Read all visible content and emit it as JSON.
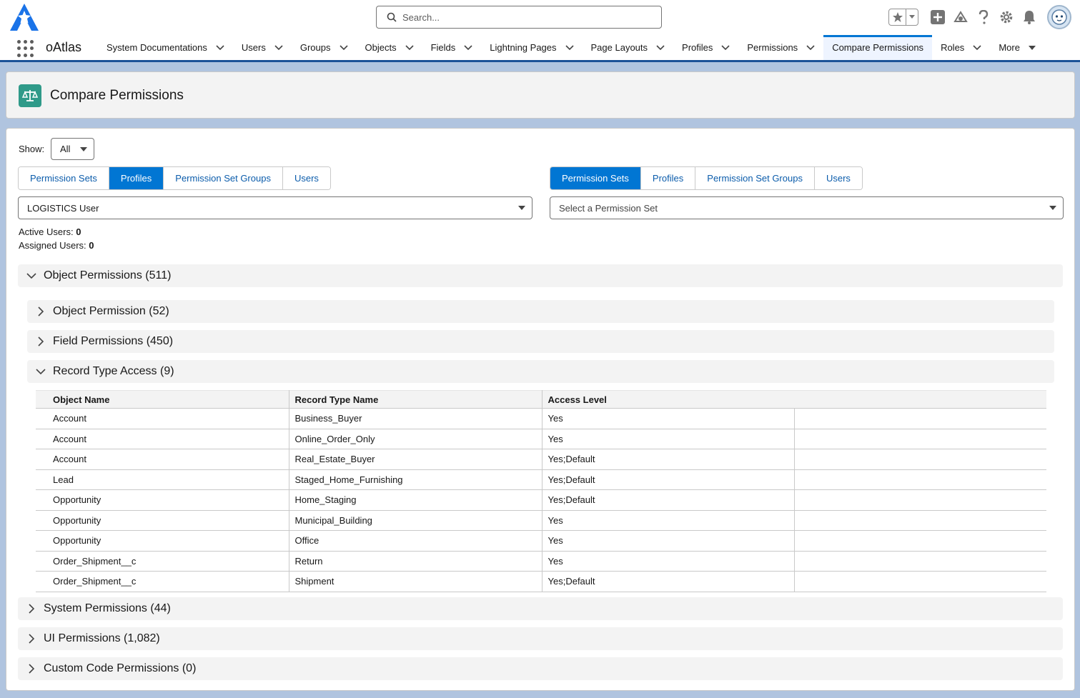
{
  "search": {
    "placeholder": "Search..."
  },
  "app": {
    "name": "oAtlas"
  },
  "nav": {
    "tabs": [
      {
        "label": "System Documentations",
        "has_menu": true
      },
      {
        "label": "Users",
        "has_menu": true
      },
      {
        "label": "Groups",
        "has_menu": true
      },
      {
        "label": "Objects",
        "has_menu": true
      },
      {
        "label": "Fields",
        "has_menu": true
      },
      {
        "label": "Lightning Pages",
        "has_menu": true
      },
      {
        "label": "Page Layouts",
        "has_menu": true
      },
      {
        "label": "Profiles",
        "has_menu": true
      },
      {
        "label": "Permissions",
        "has_menu": true
      },
      {
        "label": "Compare Permissions",
        "has_menu": false,
        "active": true
      },
      {
        "label": "Roles",
        "has_menu": true
      },
      {
        "label": "More",
        "has_menu": true
      }
    ]
  },
  "page": {
    "title": "Compare Permissions",
    "icon": "scales-icon"
  },
  "show": {
    "label": "Show:",
    "value": "All"
  },
  "left": {
    "segments": [
      "Permission Sets",
      "Profiles",
      "Permission Set Groups",
      "Users"
    ],
    "selected": 1,
    "combo_value": "LOGISTICS User"
  },
  "right": {
    "segments": [
      "Permission Sets",
      "Profiles",
      "Permission Set Groups",
      "Users"
    ],
    "selected": 0,
    "combo_placeholder": "Select a Permission Set"
  },
  "stats": {
    "active_label": "Active Users:",
    "active_value": "0",
    "assigned_label": "Assigned Users:",
    "assigned_value": "0"
  },
  "sections": {
    "object_permissions": "Object Permissions (511)",
    "object_permission": "Object Permission (52)",
    "field_permissions": "Field Permissions (450)",
    "record_type_access": "Record Type Access (9)",
    "system_permissions": "System Permissions (44)",
    "ui_permissions": "UI Permissions (1,082)",
    "custom_code_permissions": "Custom Code Permissions (0)"
  },
  "record_table": {
    "headers": [
      "Object Name",
      "Record Type Name",
      "Access Level"
    ],
    "rows": [
      [
        "Account",
        "Business_Buyer",
        "Yes"
      ],
      [
        "Account",
        "Online_Order_Only",
        "Yes"
      ],
      [
        "Account",
        "Real_Estate_Buyer",
        "Yes;Default"
      ],
      [
        "Lead",
        "Staged_Home_Furnishing",
        "Yes;Default"
      ],
      [
        "Opportunity",
        "Home_Staging",
        "Yes;Default"
      ],
      [
        "Opportunity",
        "Municipal_Building",
        "Yes"
      ],
      [
        "Opportunity",
        "Office",
        "Yes"
      ],
      [
        "Order_Shipment__c",
        "Return",
        "Yes"
      ],
      [
        "Order_Shipment__c",
        "Shipment",
        "Yes;Default"
      ]
    ]
  },
  "colors": {
    "brand_blue": "#0176d3",
    "link_blue": "#0b5cab",
    "page_icon_green": "#2f9a89"
  }
}
